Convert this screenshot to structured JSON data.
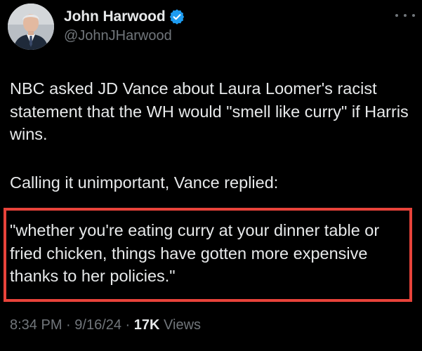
{
  "author": {
    "display_name": "John Harwood",
    "handle": "@JohnJHarwood",
    "verified": true,
    "avatar_icon": "profile-photo"
  },
  "tweet": {
    "paragraph1": "NBC asked JD Vance about Laura Loomer's racist statement that the WH would \"smell like curry\" if Harris wins.",
    "paragraph2": "Calling it unimportant, Vance replied:",
    "quote": "\"whether you're eating curry at your dinner table or fried chicken, things have gotten more expensive thanks to her policies.\"",
    "highlight_color": "#e8433a"
  },
  "meta": {
    "time": "8:34 PM",
    "separator1": " · ",
    "date": "9/16/24",
    "separator2": " · ",
    "views_count": "17K",
    "views_label": " Views"
  },
  "colors": {
    "background": "#000000",
    "text": "#e7e9ea",
    "secondary": "#71767b",
    "verified": "#1d9bf0"
  }
}
